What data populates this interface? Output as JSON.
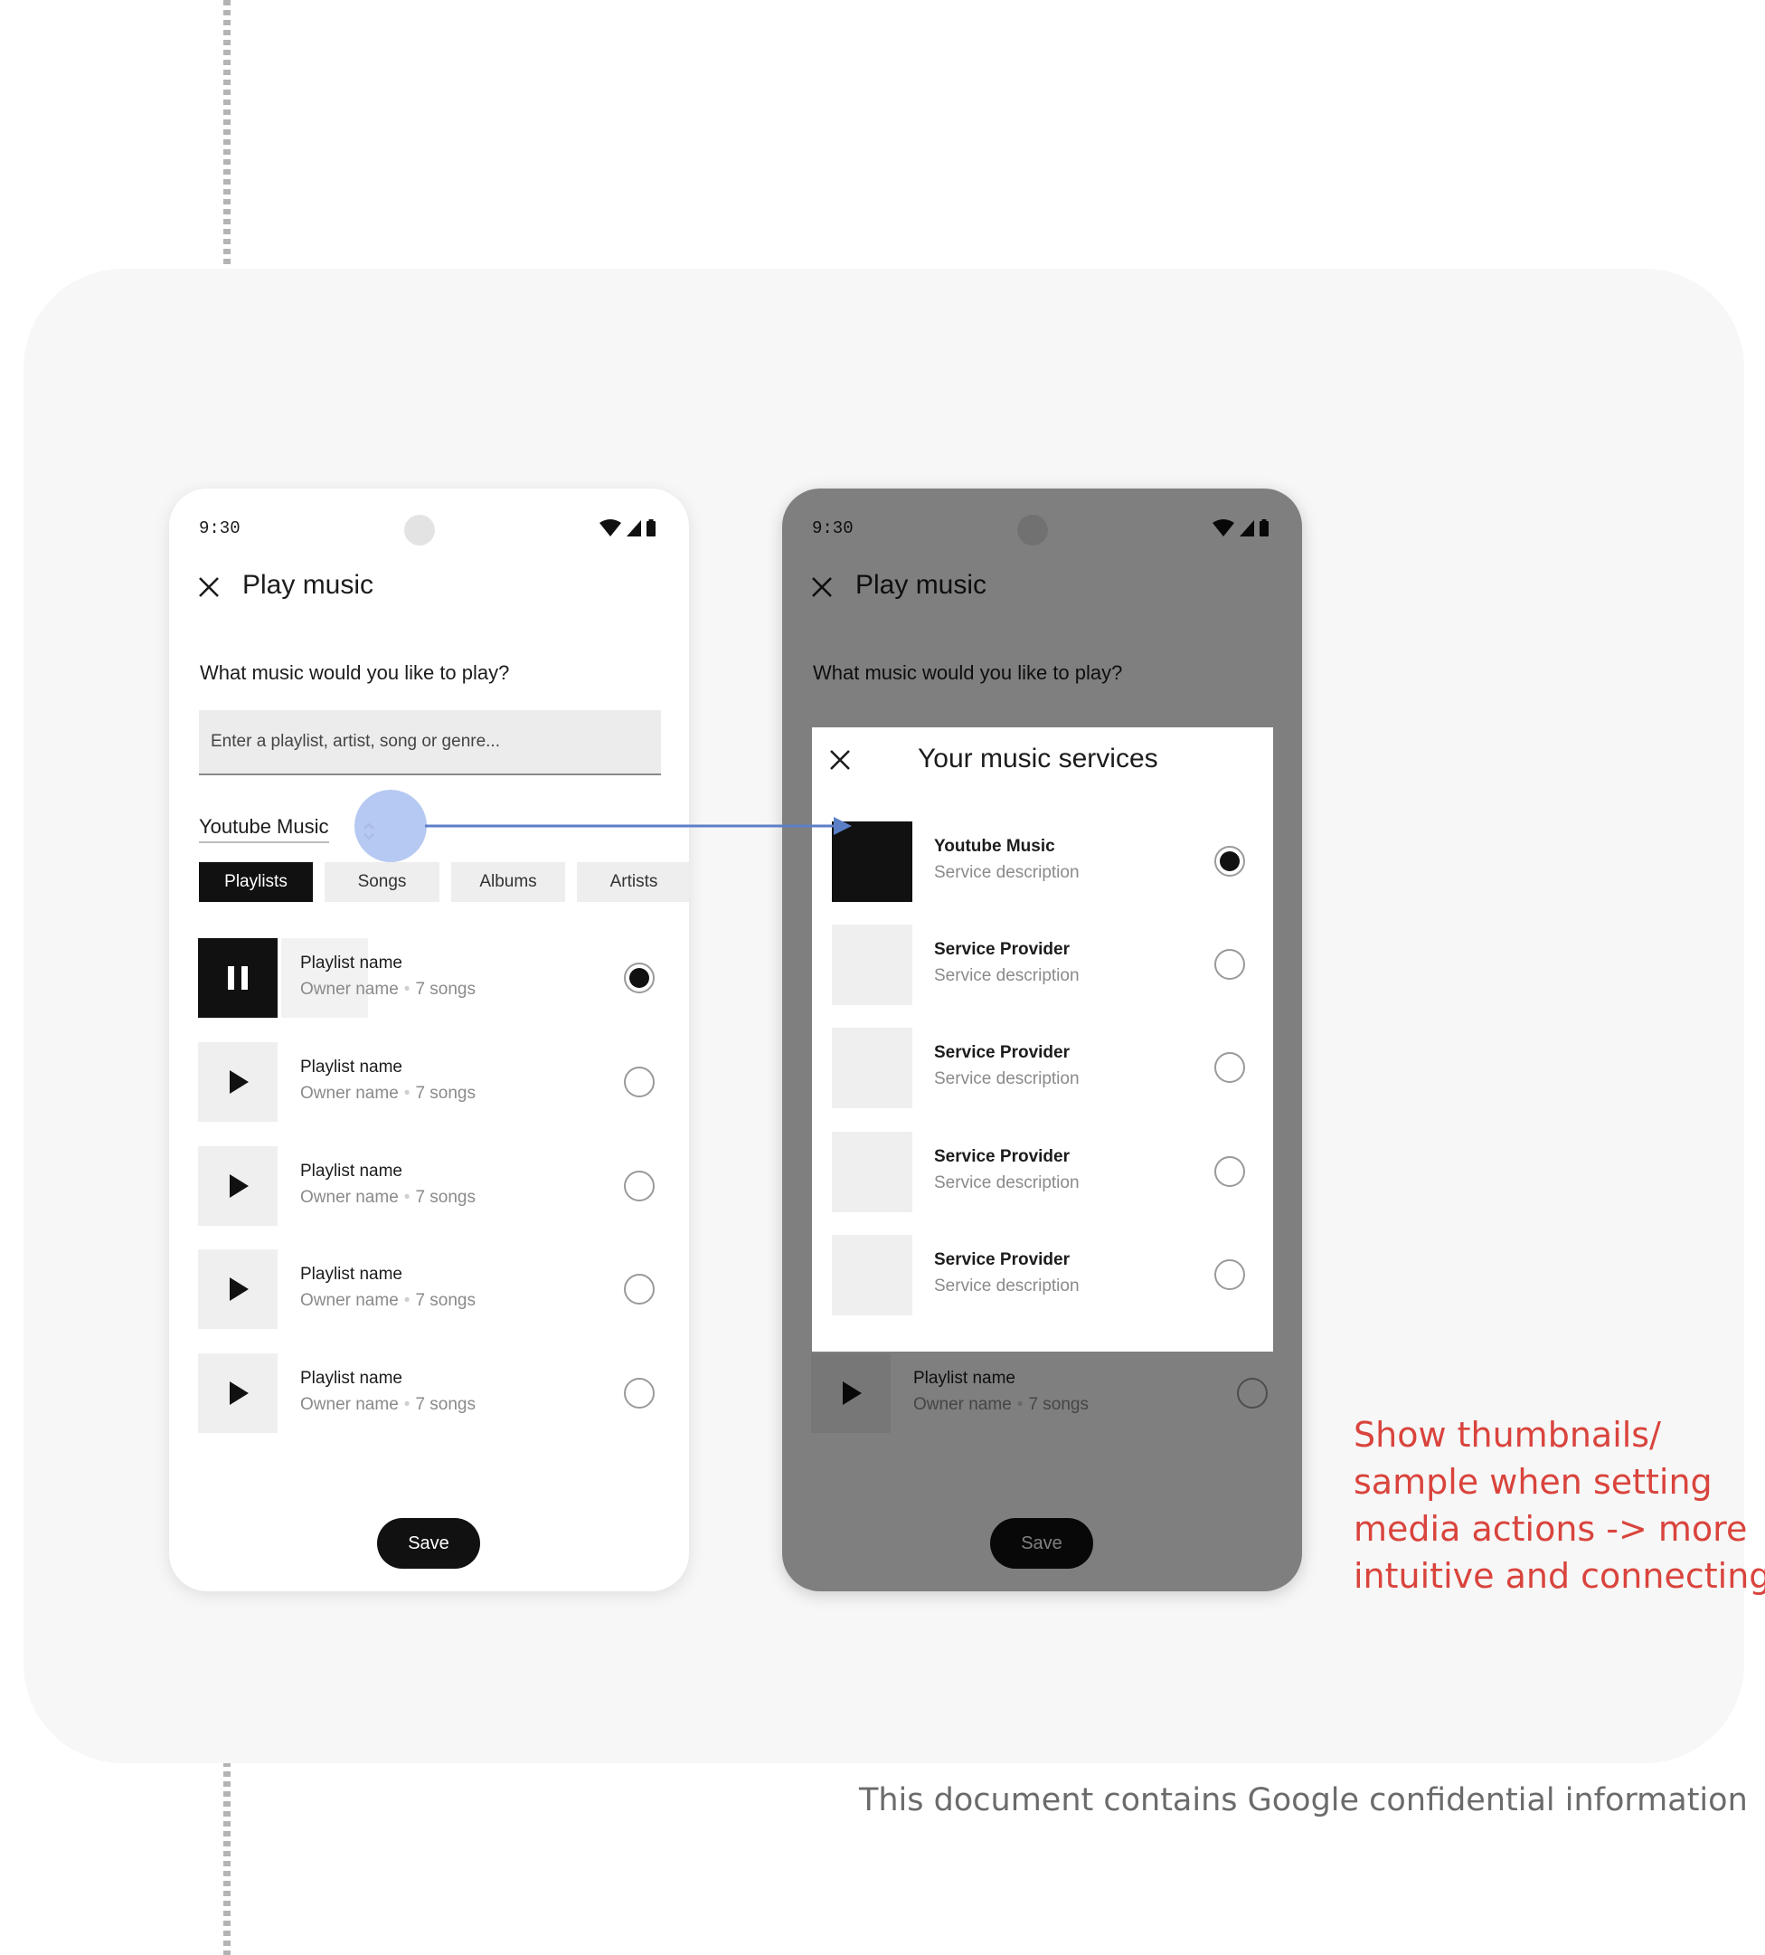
{
  "status_bar": {
    "time": "9:30"
  },
  "app": {
    "title": "Play music",
    "question": "What music would you like to play?",
    "search_placeholder": "Enter a playlist, artist, song or genre...",
    "selected_service": "Youtube Music",
    "tabs": [
      {
        "label": "Playlists",
        "active": true
      },
      {
        "label": "Songs",
        "active": false
      },
      {
        "label": "Albums",
        "active": false
      },
      {
        "label": "Artists",
        "active": false
      }
    ],
    "playlists": [
      {
        "name": "Playlist name",
        "owner": "Owner name",
        "count": "7 songs",
        "state": "playing",
        "selected": true
      },
      {
        "name": "Playlist name",
        "owner": "Owner name",
        "count": "7 songs",
        "state": "paused",
        "selected": false
      },
      {
        "name": "Playlist name",
        "owner": "Owner name",
        "count": "7 songs",
        "state": "paused",
        "selected": false
      },
      {
        "name": "Playlist name",
        "owner": "Owner name",
        "count": "7 songs",
        "state": "paused",
        "selected": false
      },
      {
        "name": "Playlist name",
        "owner": "Owner name",
        "count": "7 songs",
        "state": "paused",
        "selected": false
      }
    ],
    "save_label": "Save"
  },
  "dialog": {
    "title": "Your music services",
    "services": [
      {
        "name": "Youtube Music",
        "description": "Service description",
        "selected": true
      },
      {
        "name": "Service Provider",
        "description": "Service description",
        "selected": false
      },
      {
        "name": "Service Provider",
        "description": "Service description",
        "selected": false
      },
      {
        "name": "Service Provider",
        "description": "Service description",
        "selected": false
      },
      {
        "name": "Service Provider",
        "description": "Service description",
        "selected": false
      }
    ]
  },
  "annotation": {
    "lines": [
      "Show thumbnails/",
      "sample when setting",
      "media actions -> more",
      "intuitive and connecting"
    ]
  },
  "footer": "This document contains Google confidential information",
  "colors": {
    "annotation": "#d9443d",
    "connector": "#5b7fc7",
    "touch_indicator": "#a9bff0"
  },
  "icons": [
    "close-icon",
    "wifi-icon",
    "signal-icon",
    "battery-icon",
    "pause-icon",
    "play-icon",
    "chevron-updown-icon"
  ]
}
